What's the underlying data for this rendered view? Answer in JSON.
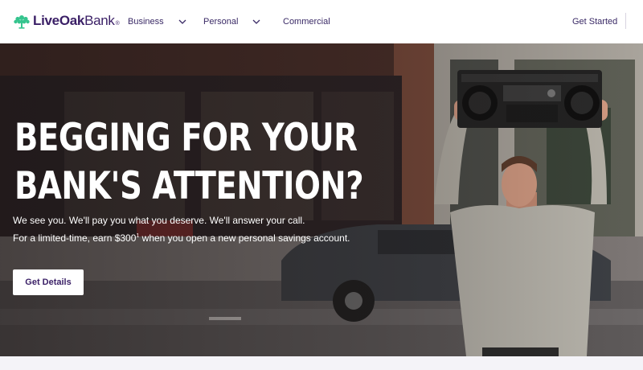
{
  "brand": {
    "name_bold": "LiveOak",
    "name_light": "Bank",
    "mark": "®",
    "accent": "#35c48e",
    "text_color": "#3a1f66"
  },
  "nav": {
    "items": [
      {
        "label": "Business",
        "icon": "chevron-down-icon"
      },
      {
        "label": "Personal",
        "icon": "chevron-down-icon"
      },
      {
        "label": "Commercial"
      }
    ],
    "get_started": "Get Started"
  },
  "hero": {
    "headline_line1": "BEGGING FOR YOUR",
    "headline_line2": "BANK'S ATTENTION?",
    "sub_line1": "We see you. We'll pay you what you deserve. We'll answer your call.",
    "sub_line2_pre": "For a limited-time, earn $300",
    "sub_line2_sup": "1",
    "sub_line2_post": " when you open a new personal savings account.",
    "cta": "Get Details"
  }
}
